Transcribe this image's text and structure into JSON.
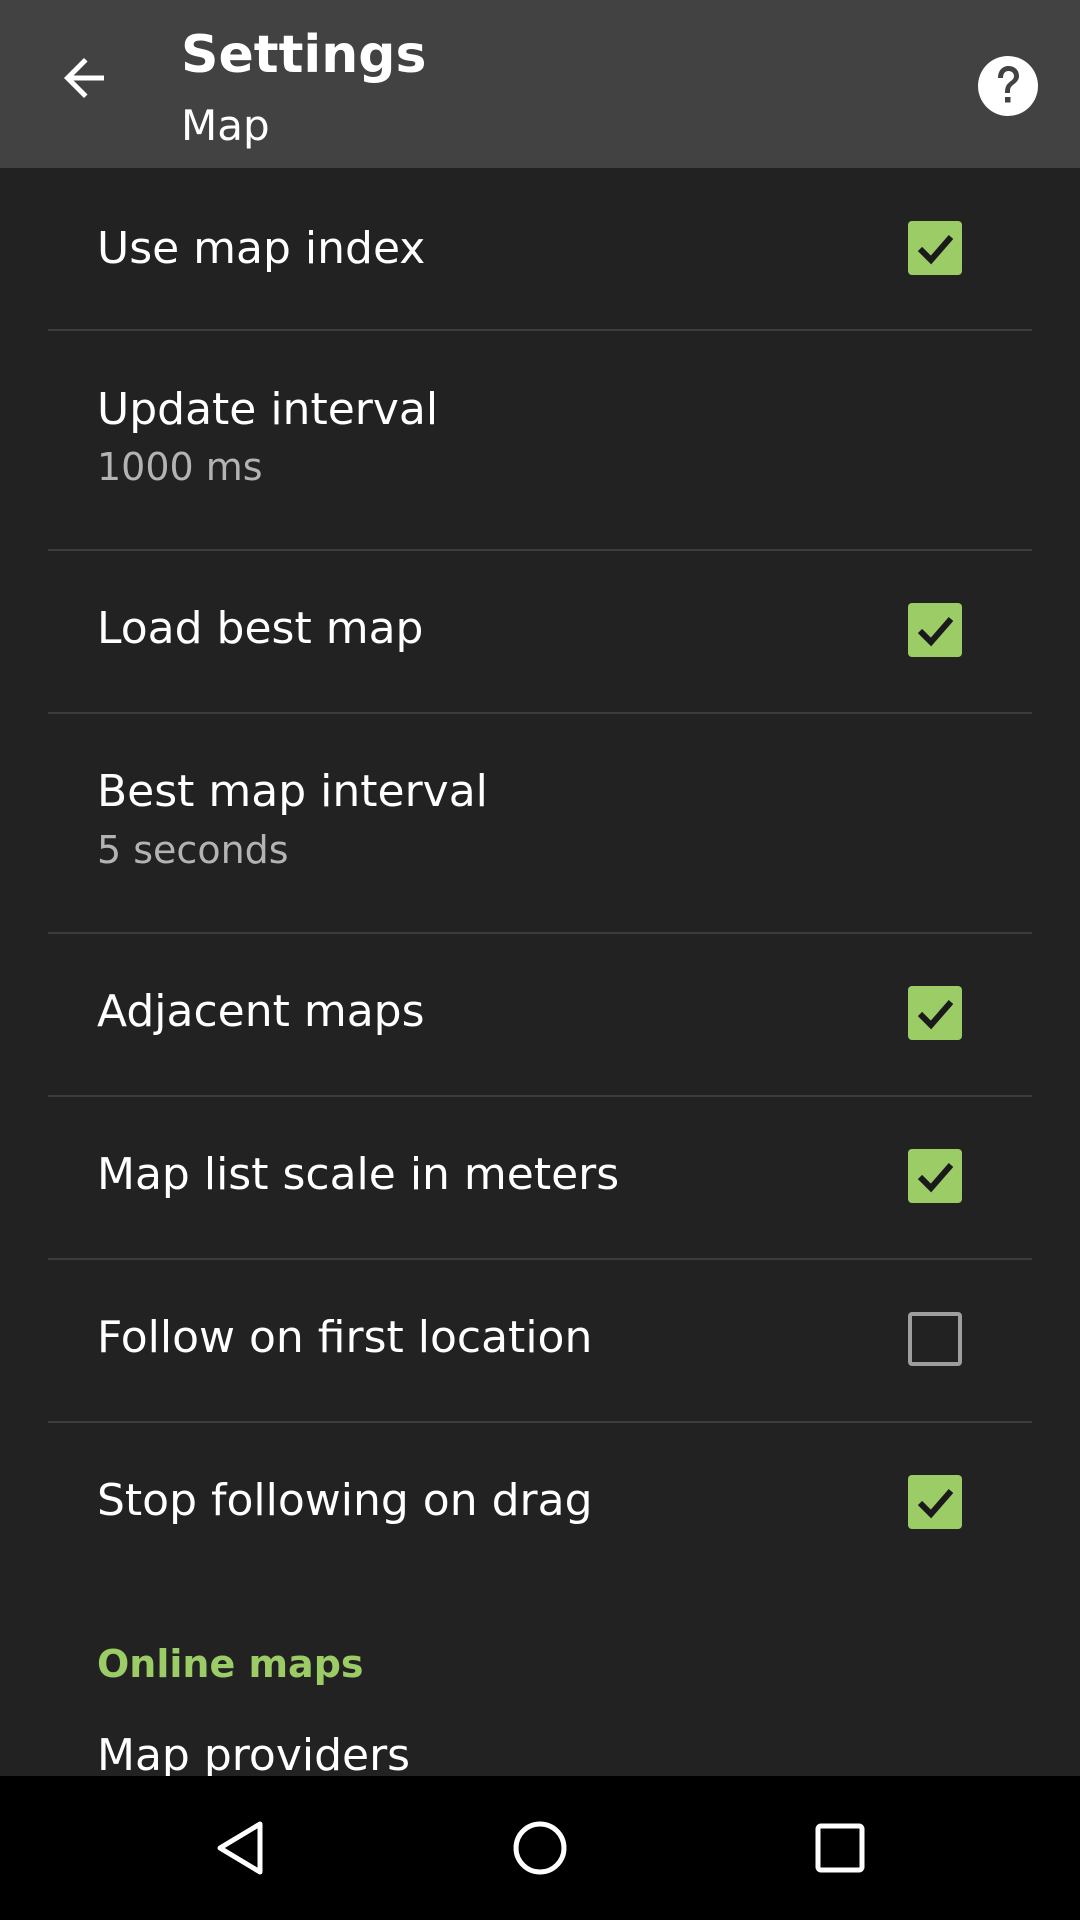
{
  "appbar": {
    "back_icon": "arrow-left-icon",
    "title": "Settings",
    "subtitle": "Map",
    "help_icon": "help-circle-icon"
  },
  "settings": [
    {
      "title": "Use map index",
      "checked": true
    },
    {
      "title": "Update interval",
      "summary": "1000 ms"
    },
    {
      "title": "Load best map",
      "checked": true
    },
    {
      "title": "Best map interval",
      "summary": "5 seconds"
    },
    {
      "title": "Adjacent maps",
      "checked": true
    },
    {
      "title": "Map list scale in meters",
      "checked": true
    },
    {
      "title": "Follow on first location",
      "checked": false
    },
    {
      "title": "Stop following on drag",
      "checked": true
    }
  ],
  "online_maps": {
    "category": "Online maps",
    "first_item": "Map providers"
  },
  "navbar": {
    "back_icon": "triangle-back-icon",
    "home_icon": "circle-home-icon",
    "recents_icon": "square-recents-icon"
  },
  "colors": {
    "accent": "#9ccc65",
    "appbar": "#424242",
    "background": "#222222"
  }
}
